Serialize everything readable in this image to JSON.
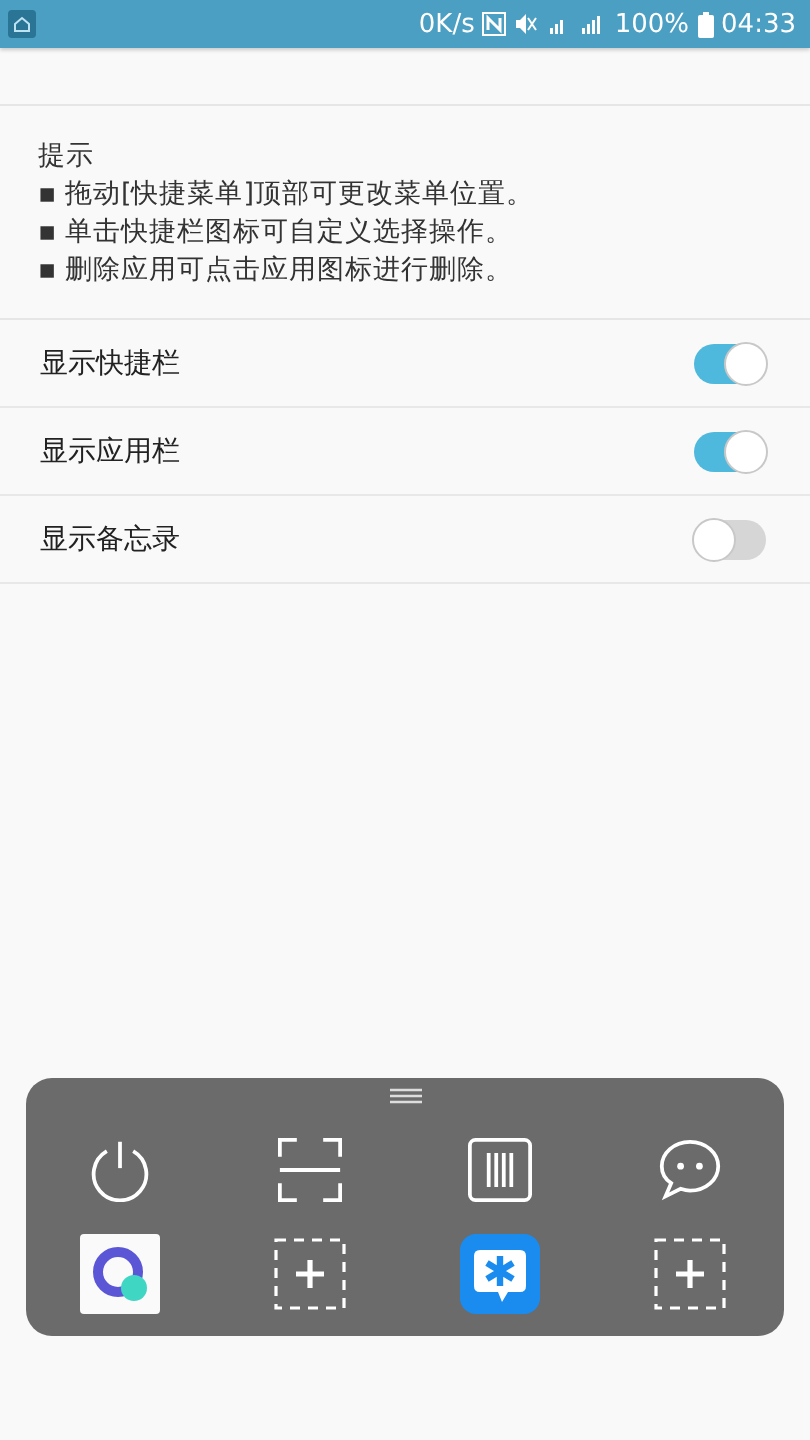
{
  "status_bar": {
    "speed": "0K/s",
    "battery": "100%",
    "time": "04:33"
  },
  "tips": {
    "title": "提示",
    "lines": [
      "▪ 拖动[快捷菜单]顶部可更改菜单位置。",
      "▪ 单击快捷栏图标可自定义选择操作。",
      "▪ 删除应用可点击应用图标进行删除。"
    ]
  },
  "settings": [
    {
      "label": "显示快捷栏",
      "on": true
    },
    {
      "label": "显示应用栏",
      "on": true
    },
    {
      "label": "显示备忘录",
      "on": false
    }
  ],
  "quick_menu": {
    "tools": [
      {
        "kind": "power"
      },
      {
        "kind": "scan"
      },
      {
        "kind": "barcode"
      },
      {
        "kind": "chat"
      }
    ],
    "apps": [
      {
        "kind": "browser"
      },
      {
        "kind": "add"
      },
      {
        "kind": "messenger"
      },
      {
        "kind": "add"
      }
    ]
  }
}
